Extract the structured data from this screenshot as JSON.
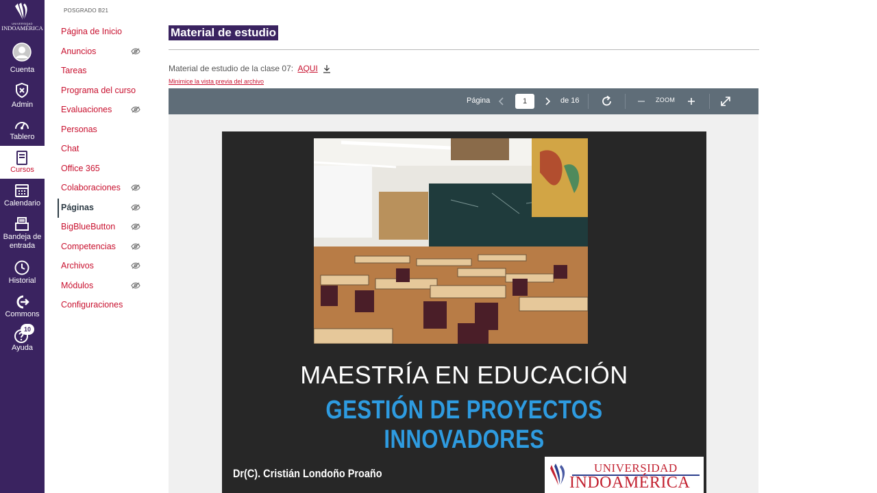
{
  "brand": {
    "line1": "UNIVERSIDAD",
    "line2": "INDOAMÉRICA"
  },
  "global_nav": [
    {
      "label": "Cuenta",
      "icon": "account-icon"
    },
    {
      "label": "Admin",
      "icon": "admin-shield-icon"
    },
    {
      "label": "Tablero",
      "icon": "dashboard-gauge-icon"
    },
    {
      "label": "Cursos",
      "icon": "courses-book-icon",
      "active": true
    },
    {
      "label": "Calendario",
      "icon": "calendar-icon"
    },
    {
      "label": "Bandeja de entrada",
      "icon": "inbox-icon"
    },
    {
      "label": "Historial",
      "icon": "history-clock-icon"
    },
    {
      "label": "Commons",
      "icon": "commons-icon"
    },
    {
      "label": "Ayuda",
      "icon": "help-icon",
      "badge": "10"
    }
  ],
  "course": {
    "name": "POSGRADO B21",
    "nav": [
      {
        "label": "Página de Inicio",
        "hidden": false
      },
      {
        "label": "Anuncios",
        "hidden": true
      },
      {
        "label": "Tareas",
        "hidden": false
      },
      {
        "label": "Programa del curso",
        "hidden": false
      },
      {
        "label": "Evaluaciones",
        "hidden": true
      },
      {
        "label": "Personas",
        "hidden": false
      },
      {
        "label": "Chat",
        "hidden": false
      },
      {
        "label": "Office 365",
        "hidden": false
      },
      {
        "label": "Colaboraciones",
        "hidden": true
      },
      {
        "label": "Páginas",
        "hidden": true,
        "active": true
      },
      {
        "label": "BigBlueButton",
        "hidden": true
      },
      {
        "label": "Competencias",
        "hidden": true
      },
      {
        "label": "Archivos",
        "hidden": true
      },
      {
        "label": "Módulos",
        "hidden": true
      },
      {
        "label": "Configuraciones",
        "hidden": false
      }
    ]
  },
  "page": {
    "title": "Material de estudio",
    "material_text": "Material de estudio de la clase 07:",
    "material_link": "AQUI",
    "minimize_link": "Minimice la vista previa del archivo"
  },
  "viewer": {
    "page_label": "Página",
    "current_page": "1",
    "of_label": "de 16",
    "zoom_label": "ZOOM"
  },
  "slide": {
    "title": "MAESTRÍA EN EDUCACIÓN",
    "subtitle": "GESTIÓN DE PROYECTOS INNOVADORES",
    "author": "Dr(C). Cristián Londoño Proaño",
    "logo_line1": "UNIVERSIDAD",
    "logo_line2": "INDOAMÉRICA"
  },
  "colors": {
    "nav_bg": "#3a2360",
    "accent_red": "#c8102e",
    "viewer_toolbar": "#5f6d78",
    "slide_bg": "#272727",
    "slide_subtitle": "#2e9be0"
  }
}
